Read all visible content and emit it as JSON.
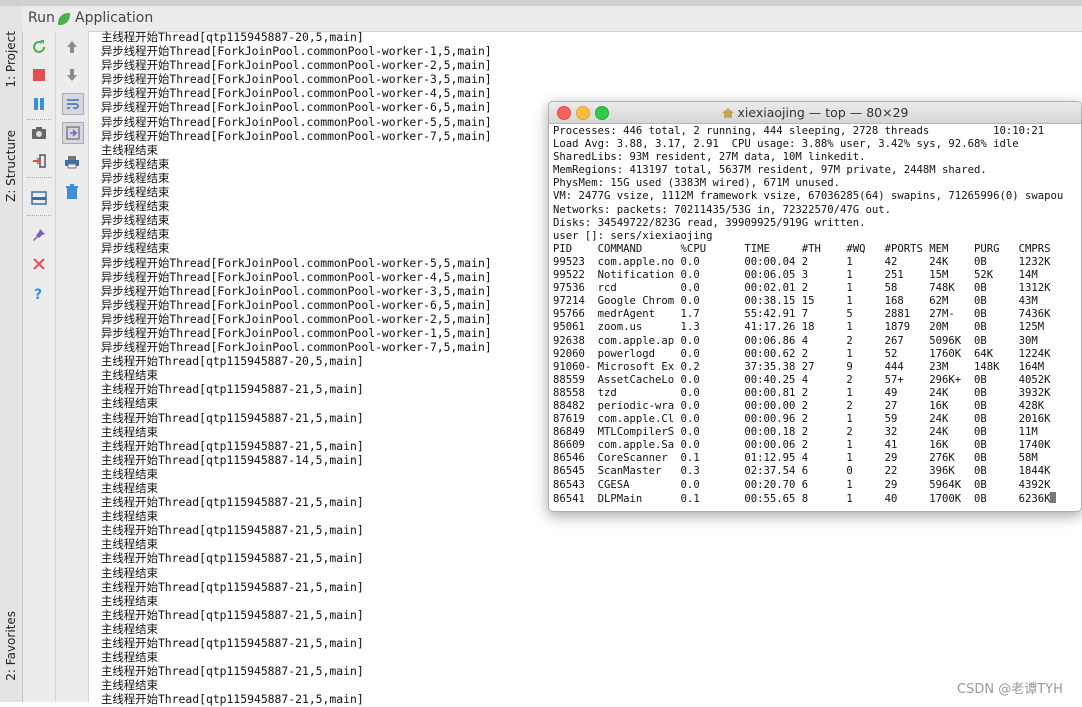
{
  "side_tabs": {
    "project": "1: Project",
    "structure": "Z: Structure",
    "favorites": "2: Favorites"
  },
  "run_panel": {
    "run_label": "Run",
    "config_name": "Application"
  },
  "console_lines": [
    "主线程开始Thread[qtp115945887-20,5,main]",
    "异步线程开始Thread[ForkJoinPool.commonPool-worker-1,5,main]",
    "异步线程开始Thread[ForkJoinPool.commonPool-worker-2,5,main]",
    "异步线程开始Thread[ForkJoinPool.commonPool-worker-3,5,main]",
    "异步线程开始Thread[ForkJoinPool.commonPool-worker-4,5,main]",
    "异步线程开始Thread[ForkJoinPool.commonPool-worker-6,5,main]",
    "异步线程开始Thread[ForkJoinPool.commonPool-worker-5,5,main]",
    "异步线程开始Thread[ForkJoinPool.commonPool-worker-7,5,main]",
    "主线程结束",
    "异步线程结束",
    "异步线程结束",
    "异步线程结束",
    "异步线程结束",
    "异步线程结束",
    "异步线程结束",
    "异步线程结束",
    "异步线程开始Thread[ForkJoinPool.commonPool-worker-5,5,main]",
    "异步线程开始Thread[ForkJoinPool.commonPool-worker-4,5,main]",
    "异步线程开始Thread[ForkJoinPool.commonPool-worker-3,5,main]",
    "异步线程开始Thread[ForkJoinPool.commonPool-worker-6,5,main]",
    "异步线程开始Thread[ForkJoinPool.commonPool-worker-2,5,main]",
    "异步线程开始Thread[ForkJoinPool.commonPool-worker-1,5,main]",
    "异步线程开始Thread[ForkJoinPool.commonPool-worker-7,5,main]",
    "主线程开始Thread[qtp115945887-20,5,main]",
    "主线程结束",
    "主线程开始Thread[qtp115945887-21,5,main]",
    "主线程结束",
    "主线程开始Thread[qtp115945887-21,5,main]",
    "主线程结束",
    "主线程开始Thread[qtp115945887-21,5,main]",
    "主线程开始Thread[qtp115945887-14,5,main]",
    "主线程结束",
    "主线程结束",
    "主线程开始Thread[qtp115945887-21,5,main]",
    "主线程结束",
    "主线程开始Thread[qtp115945887-21,5,main]",
    "主线程结束",
    "主线程开始Thread[qtp115945887-21,5,main]",
    "主线程结束",
    "主线程开始Thread[qtp115945887-21,5,main]",
    "主线程结束",
    "主线程开始Thread[qtp115945887-21,5,main]",
    "主线程结束",
    "主线程开始Thread[qtp115945887-21,5,main]",
    "主线程结束",
    "主线程开始Thread[qtp115945887-21,5,main]",
    "主线程结束",
    "主线程开始Thread[qtp115945887-21,5,main]"
  ],
  "terminal": {
    "title": "xiexiaojing — top — 80×29",
    "lines": [
      "Processes: 446 total, 2 running, 444 sleeping, 2728 threads          10:10:21",
      "Load Avg: 3.88, 3.17, 2.91  CPU usage: 3.88% user, 3.42% sys, 92.68% idle",
      "SharedLibs: 93M resident, 27M data, 10M linkedit.",
      "MemRegions: 413197 total, 5637M resident, 97M private, 2448M shared.",
      "PhysMem: 15G used (3383M wired), 671M unused.",
      "VM: 2477G vsize, 1112M framework vsize, 67036285(64) swapins, 71265996(0) swapou",
      "Networks: packets: 70211435/53G in, 72322570/47G out.",
      "Disks: 34549722/823G read, 39909925/919G written.",
      "user []: sers/xiexiaojing",
      "PID    COMMAND      %CPU      TIME     #TH    #WQ   #PORTS MEM    PURG   CMPRS",
      "99523  com.apple.no 0.0       00:00.04 2      1     42     24K    0B     1232K",
      "99522  Notification 0.0       00:06.05 3      1     251    15M    52K    14M",
      "97536  rcd          0.0       00:02.01 2      1     58     748K   0B     1312K",
      "97214  Google Chrom 0.0       00:38.15 15     1     168    62M    0B     43M",
      "95766  medrAgent    1.7       55:42.91 7      5     2881   27M-   0B     7436K",
      "95061  zoom.us      1.3       41:17.26 18     1     1879   20M    0B     125M",
      "92638  com.apple.ap 0.0       00:06.86 4      2     267    5096K  0B     30M",
      "92060  powerlogd    0.0       00:00.62 2      1     52     1760K  64K    1224K",
      "91060- Microsoft Ex 0.2       37:35.38 27     9     444    23M    148K   164M",
      "88559  AssetCacheLo 0.0       00:40.25 4      2     57+    296K+  0B     4052K",
      "88558  tzd          0.0       00:00.81 2      1     49     24K    0B     3932K",
      "88482  periodic-wra 0.0       00:00.00 2      2     27     16K    0B     428K",
      "87619  com.apple.Cl 0.0       00:00.96 2      1     59     24K    0B     2016K",
      "86849  MTLCompilerS 0.0       00:00.18 2      2     32     24K    0B     11M",
      "86609  com.apple.Sa 0.0       00:00.06 2      1     41     16K    0B     1740K",
      "86546  CoreScanner  0.1       01:12.95 4      1     29     276K   0B     58M",
      "86545  ScanMaster   0.3       02:37.54 6      0     22     396K   0B     1844K",
      "86543  CGESA        0.0       00:20.70 6      1     29     5964K  0B     4392K",
      "86541  DLPMain      0.1       00:55.65 8      1     40     1700K  0B     6236K"
    ]
  },
  "watermark": "CSDN @老谭TYH",
  "colors": {
    "green": "#4caf50",
    "red": "#e05050",
    "blue": "#3a8fd6",
    "traffic_red": "#fc605b",
    "traffic_yellow": "#fdbc40",
    "traffic_green": "#34c84a"
  },
  "icons": [
    "rerun-icon",
    "stop-icon",
    "pause-icon",
    "camera-icon",
    "login-icon",
    "layout-icon",
    "pin-icon",
    "close-icon",
    "help-icon",
    "arrow-up-icon",
    "arrow-down-icon",
    "soft-wrap-icon",
    "scroll-to-end-icon",
    "print-icon",
    "trash-icon",
    "home-icon"
  ]
}
